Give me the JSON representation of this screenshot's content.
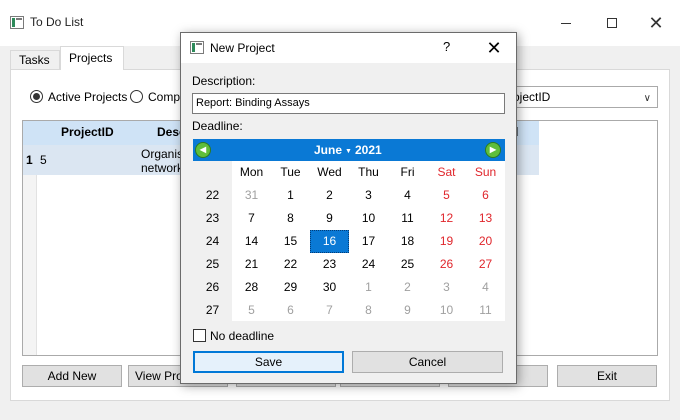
{
  "main_window": {
    "title": "To Do List",
    "tabs": [
      {
        "label": "Tasks"
      },
      {
        "label": "Projects"
      }
    ],
    "filters": {
      "active_label": "Active Projects",
      "complete_label": "Compl"
    },
    "sort_combo": {
      "value": "ojectID",
      "arrow": "∨"
    },
    "table": {
      "headers": {
        "project_id": "ProjectID",
        "description": "Desc",
        "last": "d"
      },
      "rows": [
        {
          "num": "1",
          "project_id": "5",
          "desc_line1": "Organis",
          "desc_line2": "network"
        }
      ]
    },
    "buttons": {
      "add_new": "Add New",
      "view_project": "View Proje",
      "exit": "Exit"
    }
  },
  "dialog": {
    "title": "New Project",
    "help": "?",
    "close": "✕",
    "description_label": "Description:",
    "description_value": "Report: Binding Assays",
    "deadline_label": "Deadline:",
    "calendar": {
      "month": "June",
      "year": "2021",
      "prev_glyph": "◀",
      "next_glyph": "▶",
      "weekdays": [
        "Mon",
        "Tue",
        "Wed",
        "Thu",
        "Fri",
        "Sat",
        "Sun"
      ],
      "weeks": [
        {
          "num": "22",
          "days": [
            "31",
            "1",
            "2",
            "3",
            "4",
            "5",
            "6"
          ]
        },
        {
          "num": "23",
          "days": [
            "7",
            "8",
            "9",
            "10",
            "11",
            "12",
            "13"
          ]
        },
        {
          "num": "24",
          "days": [
            "14",
            "15",
            "16",
            "17",
            "18",
            "19",
            "20"
          ]
        },
        {
          "num": "25",
          "days": [
            "21",
            "22",
            "23",
            "24",
            "25",
            "26",
            "27"
          ]
        },
        {
          "num": "26",
          "days": [
            "28",
            "29",
            "30",
            "1",
            "2",
            "3",
            "4"
          ]
        },
        {
          "num": "27",
          "days": [
            "5",
            "6",
            "7",
            "8",
            "9",
            "10",
            "11"
          ]
        }
      ],
      "selected": "16"
    },
    "no_deadline_label": "No deadline",
    "save_label": "Save",
    "cancel_label": "Cancel"
  }
}
